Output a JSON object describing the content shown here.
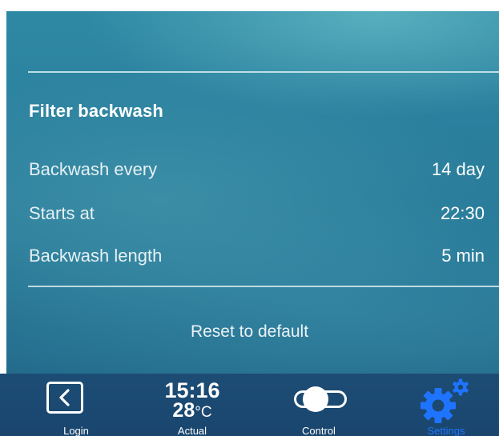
{
  "section": {
    "title": "Filter backwash"
  },
  "settings": [
    {
      "label": "Backwash every",
      "value": "14 day"
    },
    {
      "label": "Starts at",
      "value": "22:30"
    },
    {
      "label": "Backwash length",
      "value": "5 min"
    }
  ],
  "reset_label": "Reset to default",
  "tabbar": {
    "login": {
      "label": "Login",
      "icon": "back-arrow-icon"
    },
    "actual": {
      "time": "15:16",
      "temp_value": "28",
      "temp_unit": "°C",
      "label": "Actual"
    },
    "control": {
      "label": "Control",
      "icon": "toggle-icon"
    },
    "settings": {
      "label": "Settings",
      "icon": "gear-icon",
      "active": true
    }
  },
  "colors": {
    "background": "#2a7f9d",
    "tabbar": "#1b4970",
    "active_tab": "#1f74ff",
    "text": "#ffffff"
  }
}
